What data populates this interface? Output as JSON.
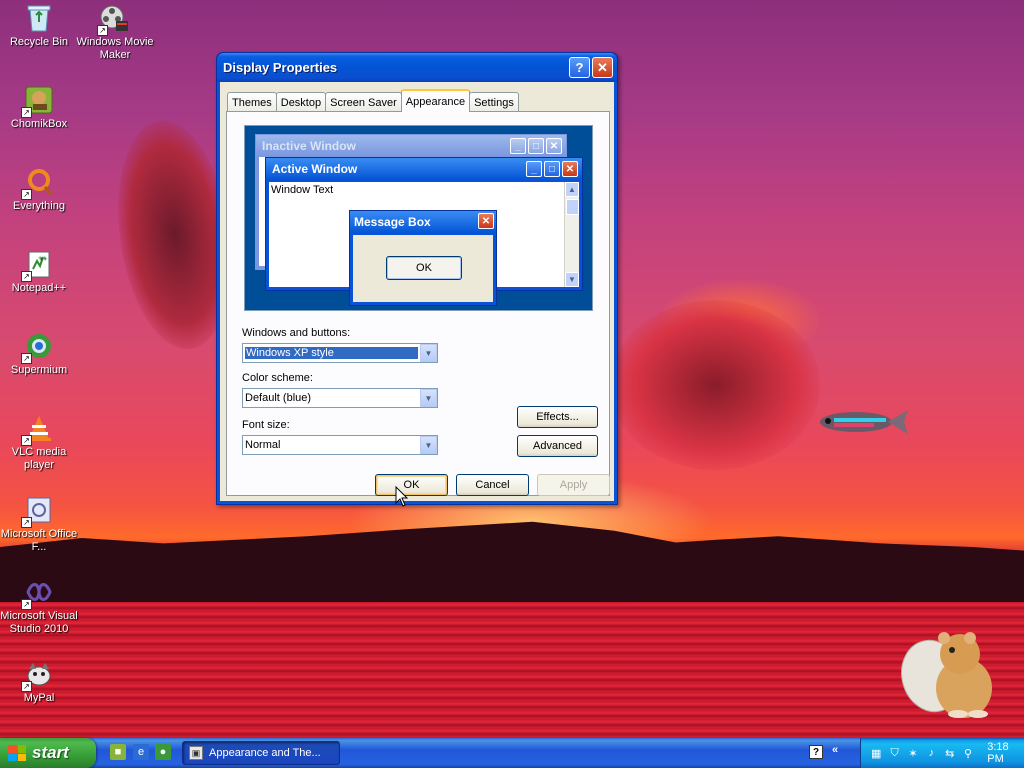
{
  "desktop": {
    "icons": [
      {
        "label": "Recycle Bin",
        "icon": "recycle-bin-icon"
      },
      {
        "label": "Windows Movie Maker",
        "icon": "movie-maker-icon"
      },
      {
        "label": "ChomikBox",
        "icon": "chomikbox-icon"
      },
      {
        "label": "Everything",
        "icon": "everything-icon"
      },
      {
        "label": "Notepad++",
        "icon": "notepad-plus-plus-icon"
      },
      {
        "label": "Supermium",
        "icon": "supermium-icon"
      },
      {
        "label": "VLC media player",
        "icon": "vlc-icon"
      },
      {
        "label": "Microsoft Office F...",
        "icon": "office-icon"
      },
      {
        "label": "Microsoft Visual Studio 2010",
        "icon": "visual-studio-icon"
      },
      {
        "label": "MyPal",
        "icon": "mypal-icon"
      }
    ]
  },
  "dialog": {
    "title": "Display Properties",
    "help_glyph": "?",
    "close_glyph": "✕",
    "tabs": [
      {
        "label": "Themes",
        "active": false
      },
      {
        "label": "Desktop",
        "active": false
      },
      {
        "label": "Screen Saver",
        "active": false
      },
      {
        "label": "Appearance",
        "active": true
      },
      {
        "label": "Settings",
        "active": false
      }
    ],
    "preview": {
      "inactive_title": "Inactive Window",
      "active_title": "Active Window",
      "window_text": "Window Text",
      "message_box_title": "Message Box",
      "message_box_ok": "OK"
    },
    "windows_and_buttons": {
      "label": "Windows and buttons:",
      "value": "Windows XP style"
    },
    "color_scheme": {
      "label": "Color scheme:",
      "value": "Default (blue)"
    },
    "font_size": {
      "label": "Font size:",
      "value": "Normal"
    },
    "effects_label": "Effects...",
    "advanced_label": "Advanced",
    "ok_label": "OK",
    "cancel_label": "Cancel",
    "apply_label": "Apply"
  },
  "taskbar": {
    "start_label": "start",
    "task_button_label": "Appearance and The...",
    "clock": "3:18 PM"
  },
  "colors": {
    "xp_blue": "#0a52d8",
    "dialog_face": "#ece9d8",
    "start_green": "#3c9c3c",
    "tray_blue": "#139ee9"
  }
}
